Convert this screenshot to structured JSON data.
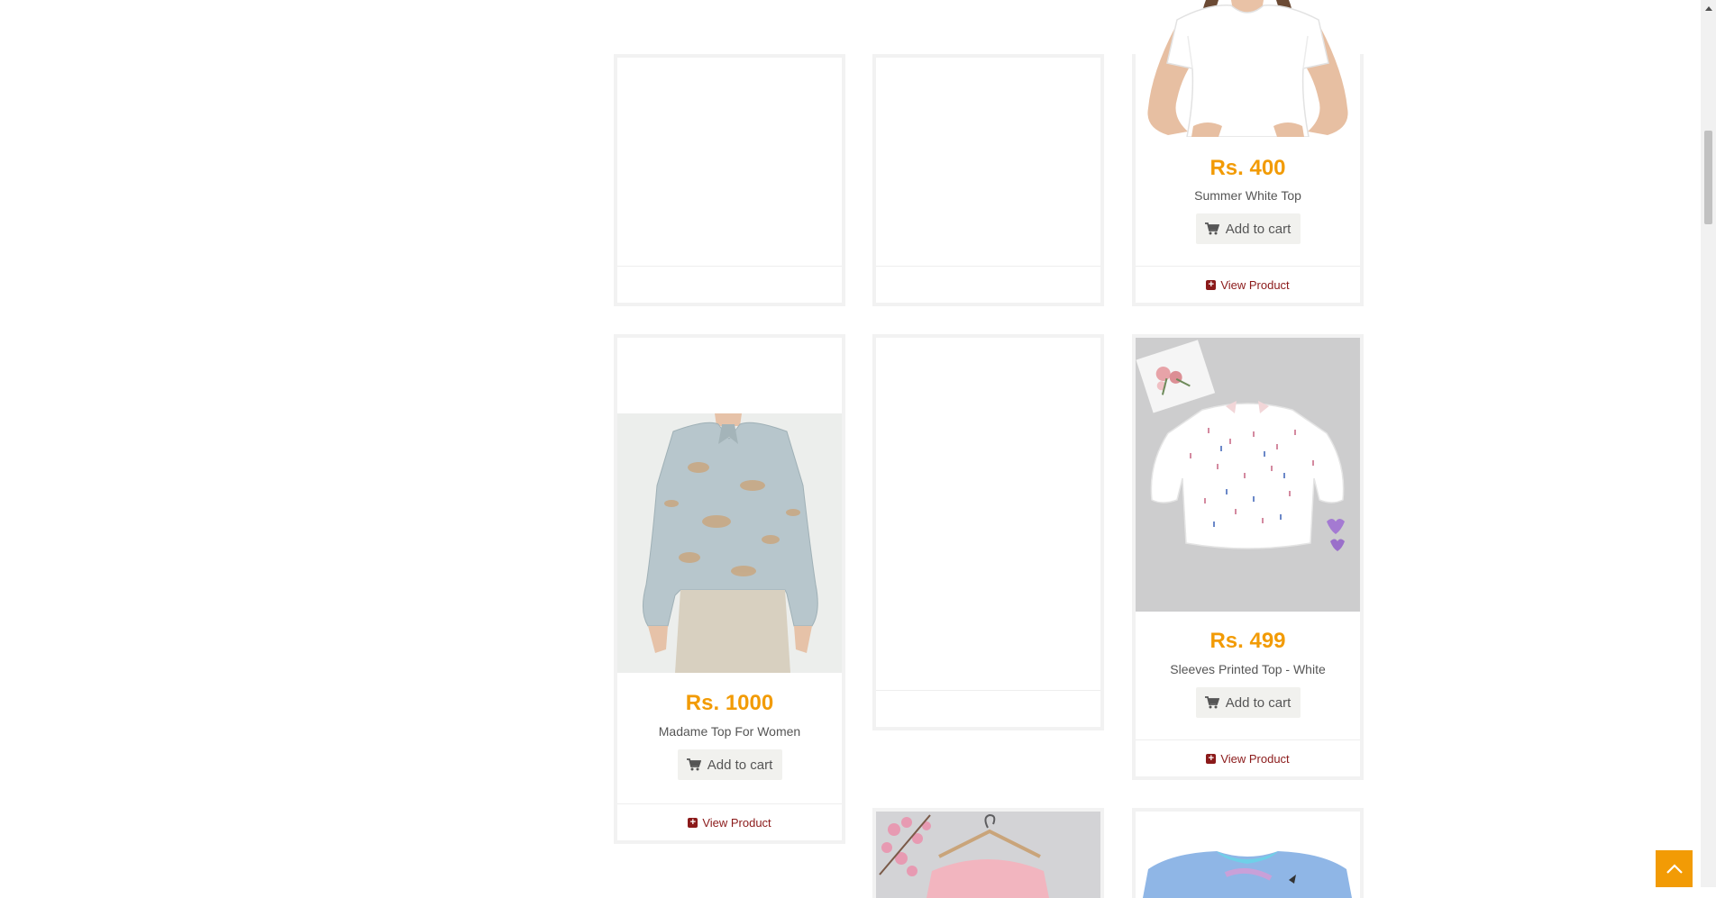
{
  "products": [
    {
      "price": "Rs. 400",
      "name": "Summer White Top",
      "cart_label": "Add to cart",
      "view_label": "View Product"
    },
    {
      "price": "Rs. 1000",
      "name": "Madame Top For Women",
      "cart_label": "Add to cart",
      "view_label": "View Product"
    },
    {
      "price": "Rs. 499",
      "name": "Sleeves Printed Top - White",
      "cart_label": "Add to cart",
      "view_label": "View Product"
    }
  ],
  "colors": {
    "accent": "#f29b05",
    "link": "#8b1a1a",
    "button_bg": "#f1f1ee"
  },
  "icons": {
    "cart": "shopping-cart-icon",
    "view": "plus-square-icon",
    "top": "chevron-up-icon"
  }
}
